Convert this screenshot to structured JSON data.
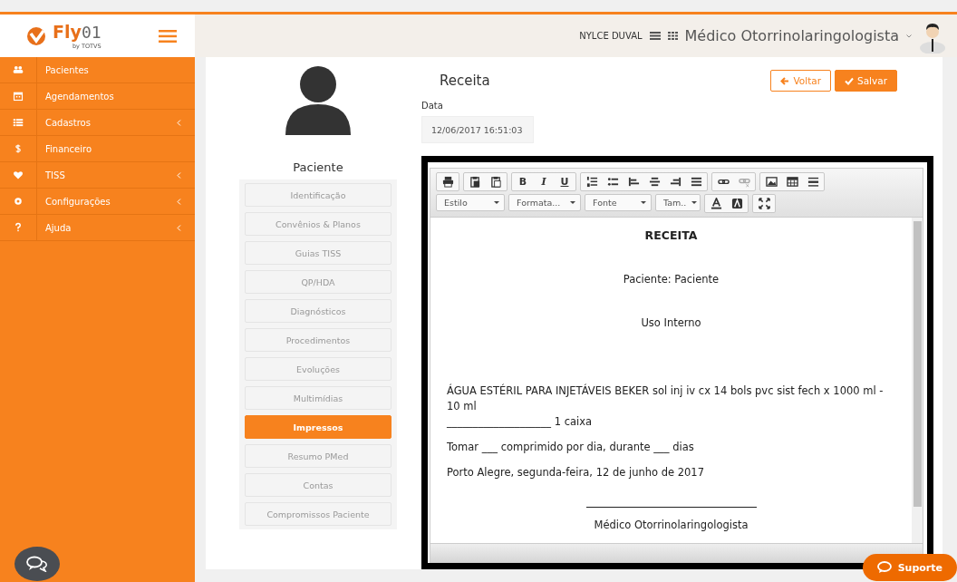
{
  "logo": {
    "name": "Fly",
    "suffix": "01",
    "byline": "by TOTVS"
  },
  "header": {
    "user": "NYLCE DUVAL",
    "role": "Médico Otorrinolaringologista"
  },
  "sidebar": {
    "items": [
      {
        "label": "Pacientes",
        "submenu": false
      },
      {
        "label": "Agendamentos",
        "submenu": false
      },
      {
        "label": "Cadastros",
        "submenu": true
      },
      {
        "label": "Financeiro",
        "submenu": false
      },
      {
        "label": "TISS",
        "submenu": true
      },
      {
        "label": "Configurações",
        "submenu": true
      },
      {
        "label": "Ajuda",
        "submenu": true
      }
    ]
  },
  "patient": {
    "title": "Paciente",
    "tabs": [
      {
        "label": "Identificação",
        "selected": false
      },
      {
        "label": "Convênios & Planos",
        "selected": false
      },
      {
        "label": "Guias TISS",
        "selected": false
      },
      {
        "label": "QP/HDA",
        "selected": false
      },
      {
        "label": "Diagnósticos",
        "selected": false
      },
      {
        "label": "Procedimentos",
        "selected": false
      },
      {
        "label": "Evoluções",
        "selected": false
      },
      {
        "label": "Multimídias",
        "selected": false
      },
      {
        "label": "Impressos",
        "selected": true
      },
      {
        "label": "Resumo PMed",
        "selected": false
      },
      {
        "label": "Contas",
        "selected": false
      },
      {
        "label": "Compromissos Paciente",
        "selected": false
      }
    ]
  },
  "form": {
    "title": "Receita",
    "buttons": [
      {
        "label": "Voltar",
        "kind": "back"
      },
      {
        "label": "Salvar",
        "kind": "save"
      }
    ],
    "date_label": "Data",
    "date_value": "12/06/2017 16:51:03"
  },
  "editor": {
    "format_buttons": [
      "B",
      "I",
      "U"
    ],
    "dropdowns": [
      "Estilo",
      "Formata...",
      "Fonte",
      "Tam.."
    ],
    "document": [
      {
        "kind": "title",
        "text": "RECEITA"
      },
      {
        "kind": "center",
        "text": "Paciente: Paciente"
      },
      {
        "kind": "center",
        "text": "Uso Interno"
      },
      {
        "kind": "left",
        "text": "ÁGUA ESTÉRIL PARA INJETÁVEIS BEKER sol inj iv cx 14 bols pvc sist fech x 1000 ml - 10 ml"
      },
      {
        "kind": "left",
        "text": "____________________ 1 caixa"
      },
      {
        "kind": "left",
        "text": "Tomar ___ comprimido por dia, durante ___ dias"
      },
      {
        "kind": "left",
        "text": "Porto Alegre, segunda-feira, 12 de junho de 2017"
      },
      {
        "kind": "signature",
        "text": "Médico Otorrinolaringologista"
      }
    ]
  },
  "support": {
    "label": "Suporte"
  }
}
